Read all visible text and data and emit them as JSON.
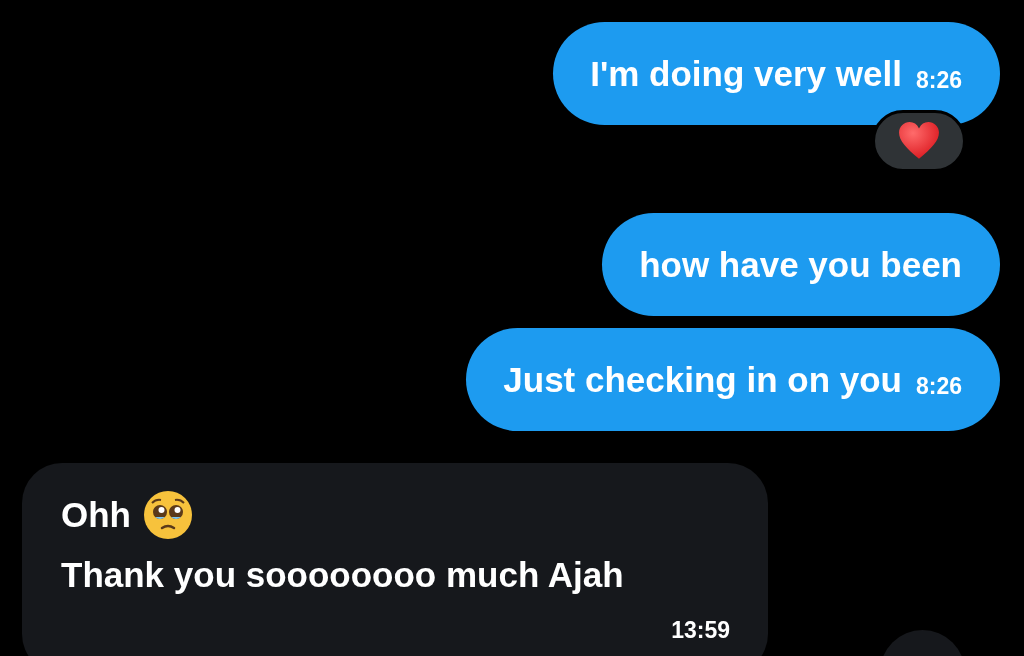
{
  "messages": [
    {
      "kind": "sent",
      "text": "I'm doing very well",
      "time": "8:26",
      "reaction": {
        "kind": "heart"
      }
    },
    {
      "kind": "sent",
      "text": "how have you been"
    },
    {
      "kind": "sent",
      "text": "Just checking in on you",
      "time": "8:26"
    },
    {
      "kind": "received",
      "lines": [
        {
          "text": "Ohh",
          "emoji": {
            "kind": "pleading-face"
          }
        },
        {
          "text": "Thank you soooooooo much Ajah"
        }
      ],
      "time": "13:59"
    }
  ]
}
